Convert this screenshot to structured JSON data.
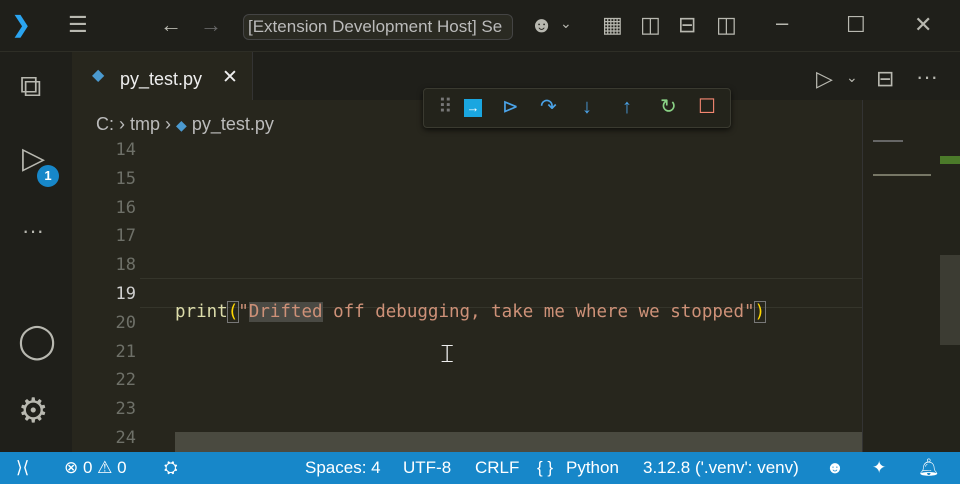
{
  "titlebar": {
    "title": "[Extension Development Host] Se"
  },
  "tab": {
    "label": "py_test.py"
  },
  "breadcrumb": {
    "drive": "C:",
    "folder": "tmp",
    "file": "py_test.py"
  },
  "activity": {
    "debug_badge": "1"
  },
  "editor": {
    "line_numbers": [
      "14",
      "15",
      "16",
      "17",
      "18",
      "19",
      "20",
      "21",
      "22",
      "23",
      "24"
    ],
    "current_line": "19",
    "code": {
      "fn": "print",
      "open": "(",
      "q1": "\"",
      "sel": "Drifted",
      "rest": " off debugging, take me where we stopped",
      "q2": "\"",
      "close": ")"
    }
  },
  "status": {
    "errors": "0",
    "warnings": "0",
    "spaces": "Spaces: 4",
    "encoding": "UTF-8",
    "eol": "CRLF",
    "lang_icon": "{ }",
    "language": "Python",
    "interpreter": "3.12.8 ('.venv': venv)"
  },
  "colors": {
    "statusbar": "#1787c9",
    "string": "#ce9178",
    "function": "#dcdcaa",
    "accent": "#0098ff"
  }
}
